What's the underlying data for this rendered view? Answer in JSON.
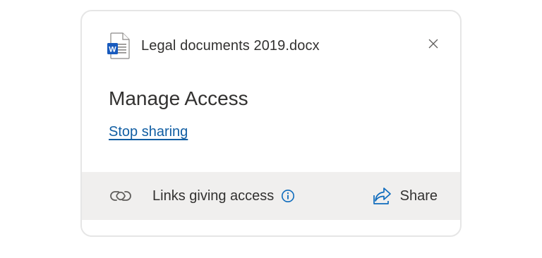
{
  "file": {
    "name": "Legal documents 2019.docx",
    "icon_badge": "W"
  },
  "dialog": {
    "title": "Manage Access",
    "stop_sharing_label": "Stop sharing"
  },
  "footer": {
    "links_label": "Links giving access",
    "share_label": "Share"
  },
  "colors": {
    "word_blue": "#185abd",
    "accent_teal": "#0f6cbd",
    "link_blue": "#115ea3",
    "footer_bg": "#f0efee",
    "text": "#323130"
  },
  "icons": {
    "file": "word-document-icon",
    "close": "close-icon",
    "links": "link-icon",
    "info": "info-icon",
    "share": "share-icon"
  }
}
